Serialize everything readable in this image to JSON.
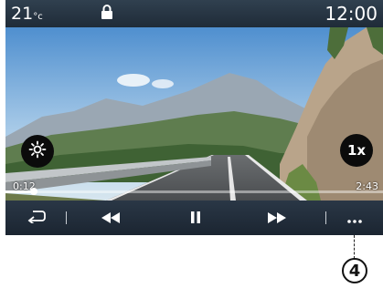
{
  "status_bar": {
    "temperature_value": "21",
    "temperature_unit": "°c",
    "lock_icon": "lock-icon",
    "clock": "12:00"
  },
  "video": {
    "brightness_icon": "brightness-icon",
    "speed_label": "1x",
    "elapsed_time": "0:12",
    "total_time": "2:43",
    "progress_fraction": 0.074
  },
  "controls": {
    "back_icon": "back-icon",
    "rewind_icon": "rewind-icon",
    "pause_icon": "pause-icon",
    "fast_forward_icon": "fast-forward-icon",
    "more_icon": "more-options-icon"
  },
  "annotation": {
    "callout_number": "4"
  },
  "colors": {
    "status_bar": "#1f2b38",
    "control_bar": "#1b2531",
    "button_bg": "#0b0b0b"
  }
}
